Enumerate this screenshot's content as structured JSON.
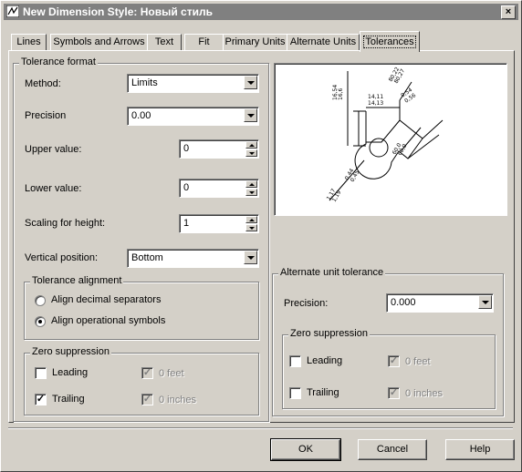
{
  "window": {
    "title": "New Dimension Style: Новый стиль",
    "close_glyph": "×"
  },
  "tabs": [
    {
      "label": "Lines",
      "active": false
    },
    {
      "label": "Symbols and Arrows",
      "active": false
    },
    {
      "label": "Text",
      "active": false
    },
    {
      "label": "Fit",
      "active": false
    },
    {
      "label": "Primary Units",
      "active": false
    },
    {
      "label": "Alternate Units",
      "active": false
    },
    {
      "label": "Tolerances",
      "active": true
    }
  ],
  "tolerance_format": {
    "legend": "Tolerance format",
    "method": {
      "label": "Method:",
      "value": "Limits"
    },
    "precision": {
      "label": "Precision",
      "value": "0.00"
    },
    "upper_value": {
      "label": "Upper value:",
      "value": "0"
    },
    "lower_value": {
      "label": "Lower value:",
      "value": "0"
    },
    "scaling": {
      "label": "Scaling for height:",
      "value": "1"
    },
    "vertical_position": {
      "label": "Vertical position:",
      "value": "Bottom"
    }
  },
  "tolerance_alignment": {
    "legend": "Tolerance alignment",
    "options": [
      {
        "label": "Align decimal separators",
        "selected": false
      },
      {
        "label": "Align operational symbols",
        "selected": true
      }
    ]
  },
  "zero_suppression_left": {
    "legend": "Zero suppression",
    "leading": {
      "label": "Leading",
      "checked": false
    },
    "trailing": {
      "label": "Trailing",
      "checked": true
    },
    "feet": {
      "label": "0 feet",
      "checked": true,
      "enabled": false
    },
    "inches": {
      "label": "0 inches",
      "checked": true,
      "enabled": false
    }
  },
  "preview": {
    "labels": [
      "16,6",
      "16,54",
      "14,11",
      "14,13",
      "0,54",
      "0,56",
      "1,17",
      "1,19",
      "0,44",
      "0,45",
      "80,22",
      "80,27",
      "60,0",
      "60,0"
    ]
  },
  "alternate_unit_tolerance": {
    "legend": "Alternate unit tolerance",
    "precision": {
      "label": "Precision:",
      "value": "0.000"
    }
  },
  "zero_suppression_right": {
    "legend": "Zero suppression",
    "leading": {
      "label": "Leading",
      "checked": false
    },
    "trailing": {
      "label": "Trailing",
      "checked": false
    },
    "feet": {
      "label": "0 feet",
      "checked": true,
      "enabled": false
    },
    "inches": {
      "label": "0 inches",
      "checked": true,
      "enabled": false
    }
  },
  "buttons": {
    "ok": "OK",
    "cancel": "Cancel",
    "help": "Help"
  },
  "check_glyph": "✓"
}
